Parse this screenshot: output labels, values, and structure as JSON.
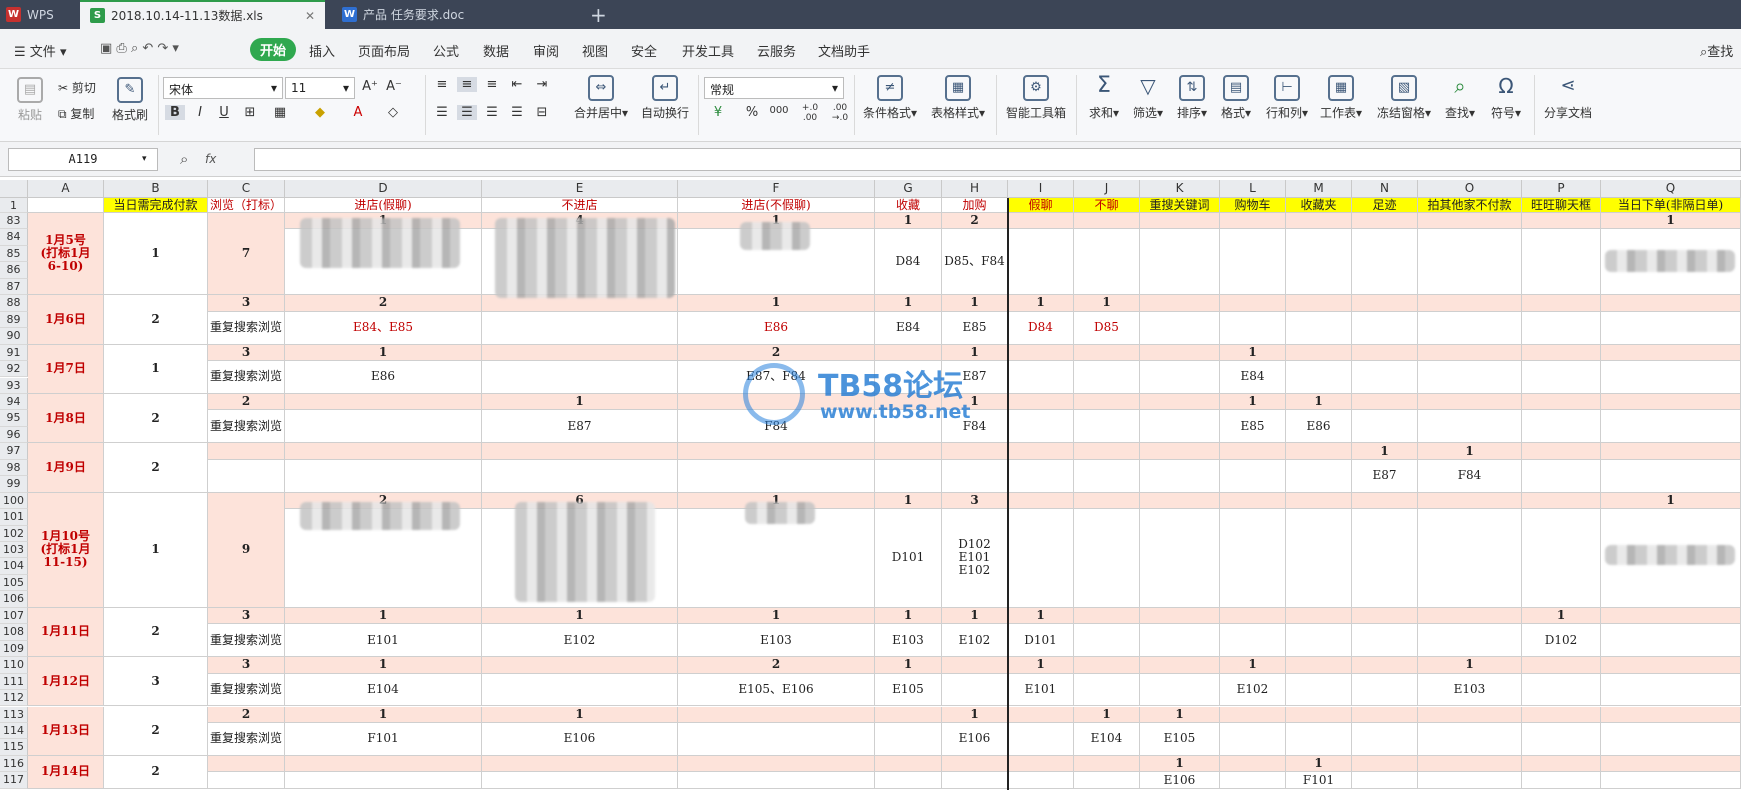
{
  "tabs": {
    "wps": "WPS",
    "xls": "2018.10.14-11.13数据.xls",
    "doc": "产品 任务要求.doc",
    "new": "+"
  },
  "menu": {
    "file": "文件",
    "items": [
      "开始",
      "插入",
      "页面布局",
      "公式",
      "数据",
      "审阅",
      "视图",
      "安全",
      "开发工具",
      "云服务",
      "文档助手"
    ],
    "search": "查找"
  },
  "ribbon": {
    "paste": "粘贴",
    "cut": "剪切",
    "copy": "复制",
    "format_painter": "格式刷",
    "font": "宋体",
    "size": "11",
    "merge": "合并居中",
    "wrap": "自动换行",
    "number_format": "常规",
    "percent": "%",
    "thousands": "000",
    "dec_inc": "+.0 .00",
    "dec_dec": ".00 →.0",
    "cond_format": "条件格式",
    "table_style": "表格样式",
    "smart_toolbox": "智能工具箱",
    "sum": "求和",
    "filter": "筛选",
    "sort": "排序",
    "format": "格式",
    "rowcol": "行和列",
    "sheet": "工作表",
    "freeze": "冻结窗格",
    "find": "查找",
    "symbol": "符号",
    "share": "分享文档"
  },
  "formula": {
    "cell_ref": "A119",
    "fx": "fx",
    "value": ""
  },
  "columns": [
    "A",
    "B",
    "C",
    "D",
    "E",
    "F",
    "G",
    "H",
    "I",
    "J",
    "K",
    "L",
    "M",
    "N",
    "O",
    "P",
    "Q"
  ],
  "headers": [
    "",
    "当日需完成付款",
    "浏览（打标）",
    "进店(假聊)",
    "不进店",
    "进店(不假聊)",
    "收藏",
    "加购",
    "假聊",
    "不聊",
    "重搜关键词",
    "购物车",
    "收藏夹",
    "足迹",
    "拍其他家不付款",
    "旺旺聊天框",
    "当日下单(非隔日单)"
  ],
  "row_numbers": [
    "1",
    "83",
    "84",
    "85",
    "86",
    "87",
    "88",
    "89",
    "90",
    "91",
    "92",
    "93",
    "94",
    "95",
    "96",
    "97",
    "98",
    "99",
    "100",
    "101",
    "102",
    "103",
    "104",
    "105",
    "106",
    "107",
    "108",
    "109",
    "110",
    "111",
    "112",
    "113",
    "114",
    "115",
    "116",
    "117"
  ],
  "groups": [
    {
      "a": "1月5号\n(打标1月\n6-10)",
      "b": "1",
      "c": "7",
      "top": {
        "D": "1",
        "E": "4",
        "F": "1",
        "G": "1",
        "H": "2",
        "Q": "1"
      },
      "bot": {
        "G": "D84",
        "H": "D85、F84"
      }
    },
    {
      "a": "1月6日",
      "b": "2",
      "c": "3",
      "c2": "重复搜索浏览",
      "top": {
        "D": "2",
        "F": "1",
        "G": "1",
        "H": "1",
        "I": "1",
        "J": "1"
      },
      "bot": {
        "D": "E84、E85",
        "F": "E86",
        "G": "E84",
        "H": "E85",
        "I": "D84",
        "J": "D85"
      }
    },
    {
      "a": "1月7日",
      "b": "1",
      "c": "3",
      "c2": "重复搜索浏览",
      "top": {
        "D": "1",
        "F": "2",
        "H": "1",
        "L": "1"
      },
      "bot": {
        "D": "E86",
        "F": "E87、F84",
        "H": "E87",
        "L": "E84"
      }
    },
    {
      "a": "1月8日",
      "b": "2",
      "c": "2",
      "c2": "重复搜索浏览",
      "top": {
        "E": "1",
        "H": "1",
        "L": "1",
        "M": "1"
      },
      "bot": {
        "E": "E87",
        "F": "F84",
        "H": "F84",
        "L": "E85",
        "M": "E86"
      }
    },
    {
      "a": "1月9日",
      "b": "2",
      "c": "",
      "c2": "",
      "top": {
        "N": "1",
        "O": "1"
      },
      "bot": {
        "N": "E87",
        "O": "F84"
      }
    },
    {
      "a": "1月10号\n(打标1月\n11-15)",
      "b": "1",
      "c": "9",
      "top": {
        "D": "2",
        "E": "6",
        "F": "1",
        "G": "1",
        "H": "3",
        "Q": "1"
      },
      "bot": {
        "G": "D101",
        "H": "D102\nE101\nE102"
      }
    },
    {
      "a": "1月11日",
      "b": "2",
      "c": "3",
      "c2": "重复搜索浏览",
      "top": {
        "D": "1",
        "E": "1",
        "F": "1",
        "G": "1",
        "H": "1",
        "I": "1",
        "P": "1"
      },
      "bot": {
        "D": "E101",
        "E": "E102",
        "F": "E103",
        "G": "E103",
        "H": "E102",
        "I": "D101",
        "P": "D102"
      }
    },
    {
      "a": "1月12日",
      "b": "3",
      "c": "3",
      "c2": "重复搜索浏览",
      "top": {
        "D": "1",
        "F": "2",
        "G": "1",
        "I": "1",
        "L": "1",
        "O": "1"
      },
      "bot": {
        "D": "E104",
        "F": "E105、E106",
        "G": "E105",
        "I": "E101",
        "L": "E102",
        "O": "E103"
      }
    },
    {
      "a": "1月13日",
      "b": "2",
      "c": "2",
      "c2": "重复搜索浏览",
      "top": {
        "D": "1",
        "E": "1",
        "H": "1",
        "J": "1",
        "K": "1"
      },
      "bot": {
        "D": "F101",
        "E": "E106",
        "H": "E106",
        "J": "E104",
        "K": "E105"
      }
    },
    {
      "a": "1月14日",
      "b": "2",
      "c": "",
      "c2": "",
      "top": {
        "K": "1",
        "M": "1"
      },
      "bot": {
        "K": "E106",
        "M": "F101"
      }
    }
  ],
  "watermark": {
    "title": "TB58论坛",
    "url": "www.tb58.net"
  }
}
